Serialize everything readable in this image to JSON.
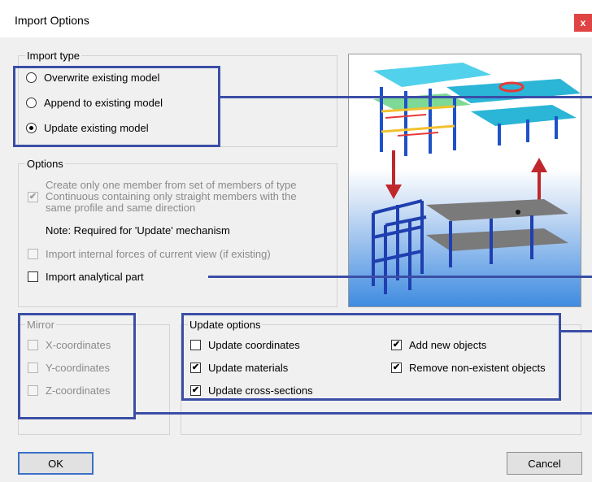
{
  "window": {
    "title": "Import Options",
    "close_label": "x"
  },
  "import_type": {
    "legend": "Import type",
    "options": [
      {
        "label": "Overwrite existing model",
        "selected": false
      },
      {
        "label": "Append to existing model",
        "selected": false
      },
      {
        "label": "Update existing model",
        "selected": true
      }
    ]
  },
  "options": {
    "legend": "Options",
    "create_one_member": {
      "label": "Create only one member from set of members of type Continuous containing only straight members with the same profile and same direction",
      "checked": true,
      "enabled": false
    },
    "note": "Note: Required for 'Update' mechanism",
    "import_internal_forces": {
      "label": "Import internal forces of current view (if existing)",
      "checked": false,
      "enabled": false
    },
    "import_analytical_part": {
      "label": "Import analytical part",
      "checked": false,
      "enabled": true
    }
  },
  "mirror": {
    "legend": "Mirror",
    "x": "X-coordinates",
    "y": "Y-coordinates",
    "z": "Z-coordinates"
  },
  "update_options": {
    "legend": "Update options",
    "coordinates": {
      "label": "Update coordinates",
      "checked": false
    },
    "materials": {
      "label": "Update materials",
      "checked": true
    },
    "cross_sections": {
      "label": "Update cross-sections",
      "checked": true
    },
    "add_new": {
      "label": "Add new objects",
      "checked": true
    },
    "remove_nonexistent": {
      "label": "Remove non-existent objects",
      "checked": true
    }
  },
  "buttons": {
    "ok": "OK",
    "cancel": "Cancel"
  },
  "check_glyph": "✔",
  "colors": {
    "highlight": "#3b4ea6",
    "arrow": "#c0272d",
    "structure_blue": "#1f3fb0",
    "close": "#e04343"
  }
}
